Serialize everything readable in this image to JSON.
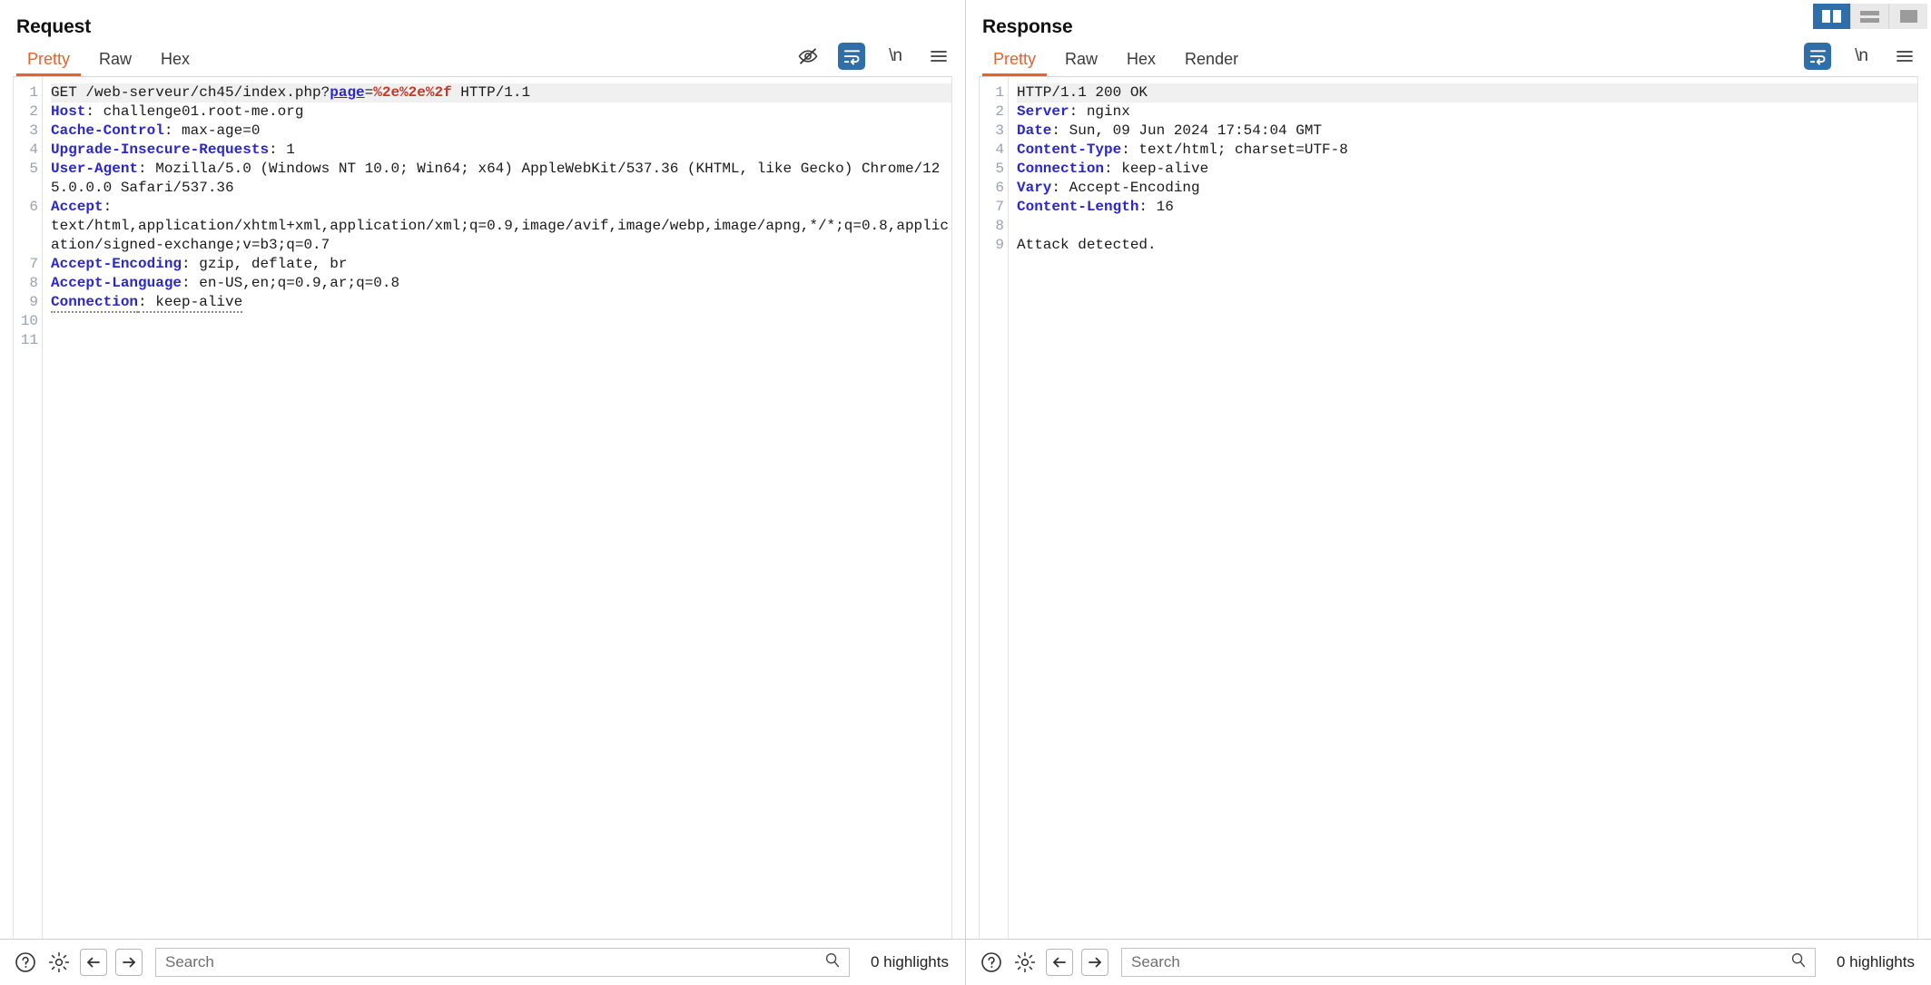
{
  "layout": {
    "buttons": [
      {
        "name": "split-vertical",
        "label": "Split vertical",
        "active": true
      },
      {
        "name": "split-horizontal",
        "label": "Split horizontal",
        "active": false
      },
      {
        "name": "single-pane",
        "label": "Single pane",
        "active": false
      }
    ],
    "accent_color": "#e8622a",
    "active_color": "#2f6ea8"
  },
  "request": {
    "title": "Request",
    "tabs": [
      {
        "label": "Pretty",
        "active": true
      },
      {
        "label": "Raw",
        "active": false
      },
      {
        "label": "Hex",
        "active": false
      }
    ],
    "tools": [
      {
        "name": "eye-slash-icon",
        "label": "Hide",
        "active": false
      },
      {
        "name": "word-wrap-icon",
        "label": "Word wrap",
        "active": true
      },
      {
        "name": "newline-icon",
        "label": "\\n",
        "active": false
      },
      {
        "name": "menu-icon",
        "label": "Menu",
        "active": false
      }
    ],
    "line_numbers": [
      "1",
      "2",
      "3",
      "4",
      "5",
      "",
      "6",
      "",
      "",
      "7",
      "8",
      "9",
      "10",
      "11"
    ],
    "lines": [
      {
        "n": "1",
        "highlight": true,
        "parts": [
          {
            "t": "GET /web-serveur/ch45/index.php?",
            "c": "val"
          },
          {
            "t": "page",
            "c": "param"
          },
          {
            "t": "=",
            "c": "val"
          },
          {
            "t": "%2e%2e%2f",
            "c": "enc"
          },
          {
            "t": " HTTP/1.1",
            "c": "val"
          }
        ]
      },
      {
        "n": "2",
        "parts": [
          {
            "t": "Host",
            "c": "hdr"
          },
          {
            "t": ": challenge01.root-me.org",
            "c": "val"
          }
        ]
      },
      {
        "n": "3",
        "parts": [
          {
            "t": "Cache-Control",
            "c": "hdr"
          },
          {
            "t": ": max-age=0",
            "c": "val"
          }
        ]
      },
      {
        "n": "4",
        "parts": [
          {
            "t": "Upgrade-Insecure-Requests",
            "c": "hdr"
          },
          {
            "t": ": 1",
            "c": "val"
          }
        ]
      },
      {
        "n": "5",
        "parts": [
          {
            "t": "User-Agent",
            "c": "hdr"
          },
          {
            "t": ": Mozilla/5.0 (Windows NT 10.0; Win64; x64) AppleWebKit/537.36 (KHTML, like Gecko) Chrome/125.0.0.0 Safari/537.36",
            "c": "val"
          }
        ]
      },
      {
        "n": "6",
        "parts": [
          {
            "t": "Accept",
            "c": "hdr"
          },
          {
            "t": ": \ntext/html,application/xhtml+xml,application/xml;q=0.9,image/avif,image/webp,image/apng,*/*;q=0.8,application/signed-exchange;v=b3;q=0.7",
            "c": "val"
          }
        ]
      },
      {
        "n": "7",
        "parts": [
          {
            "t": "Accept-Encoding",
            "c": "hdr"
          },
          {
            "t": ": gzip, deflate, br",
            "c": "val"
          }
        ]
      },
      {
        "n": "8",
        "parts": [
          {
            "t": "Accept-Language",
            "c": "hdr"
          },
          {
            "t": ": en-US,en;q=0.9,ar;q=0.8",
            "c": "val"
          }
        ]
      },
      {
        "n": "9",
        "dotted": true,
        "parts": [
          {
            "t": "Connection",
            "c": "hdr"
          },
          {
            "t": ": keep-alive",
            "c": "val"
          }
        ]
      },
      {
        "n": "10",
        "parts": []
      },
      {
        "n": "11",
        "parts": []
      }
    ]
  },
  "response": {
    "title": "Response",
    "tabs": [
      {
        "label": "Pretty",
        "active": true
      },
      {
        "label": "Raw",
        "active": false
      },
      {
        "label": "Hex",
        "active": false
      },
      {
        "label": "Render",
        "active": false
      }
    ],
    "tools": [
      {
        "name": "word-wrap-icon",
        "label": "Word wrap",
        "active": true
      },
      {
        "name": "newline-icon",
        "label": "\\n",
        "active": false
      },
      {
        "name": "menu-icon",
        "label": "Menu",
        "active": false
      }
    ],
    "lines": [
      {
        "n": "1",
        "highlight": true,
        "parts": [
          {
            "t": "HTTP/1.1 200 OK",
            "c": "val"
          }
        ]
      },
      {
        "n": "2",
        "parts": [
          {
            "t": "Server",
            "c": "hdr"
          },
          {
            "t": ": nginx",
            "c": "val"
          }
        ]
      },
      {
        "n": "3",
        "parts": [
          {
            "t": "Date",
            "c": "hdr"
          },
          {
            "t": ": Sun, 09 Jun 2024 17:54:04 GMT",
            "c": "val"
          }
        ]
      },
      {
        "n": "4",
        "parts": [
          {
            "t": "Content-Type",
            "c": "hdr"
          },
          {
            "t": ": text/html; charset=UTF-8",
            "c": "val"
          }
        ]
      },
      {
        "n": "5",
        "parts": [
          {
            "t": "Connection",
            "c": "hdr"
          },
          {
            "t": ": keep-alive",
            "c": "val"
          }
        ]
      },
      {
        "n": "6",
        "parts": [
          {
            "t": "Vary",
            "c": "hdr"
          },
          {
            "t": ": Accept-Encoding",
            "c": "val"
          }
        ]
      },
      {
        "n": "7",
        "parts": [
          {
            "t": "Content-Length",
            "c": "hdr"
          },
          {
            "t": ": 16",
            "c": "val"
          }
        ]
      },
      {
        "n": "8",
        "parts": []
      },
      {
        "n": "9",
        "parts": [
          {
            "t": "Attack detected.",
            "c": "val"
          }
        ]
      }
    ]
  },
  "footer": {
    "request": {
      "help_label": "?",
      "search_value": "",
      "search_placeholder": "Search",
      "highlights": "0 highlights"
    },
    "response": {
      "help_label": "?",
      "search_value": "",
      "search_placeholder": "Search",
      "highlights": "0 highlights"
    }
  }
}
